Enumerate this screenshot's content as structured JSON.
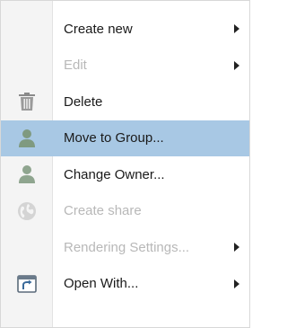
{
  "menu": {
    "items": [
      {
        "label": "Create new",
        "icon": "",
        "submenu": true,
        "disabled": false,
        "highlighted": false
      },
      {
        "label": "Edit",
        "icon": "",
        "submenu": true,
        "disabled": true,
        "highlighted": false
      },
      {
        "label": "Delete",
        "icon": "trash-icon",
        "submenu": false,
        "disabled": false,
        "highlighted": false
      },
      {
        "label": "Move to Group...",
        "icon": "user-icon",
        "submenu": false,
        "disabled": false,
        "highlighted": true
      },
      {
        "label": "Change Owner...",
        "icon": "user-icon",
        "submenu": false,
        "disabled": false,
        "highlighted": false
      },
      {
        "label": "Create share",
        "icon": "globe-icon",
        "submenu": false,
        "disabled": true,
        "highlighted": false
      },
      {
        "label": "Rendering Settings...",
        "icon": "",
        "submenu": true,
        "disabled": true,
        "highlighted": false
      },
      {
        "label": "Open With...",
        "icon": "open-with-icon",
        "submenu": true,
        "disabled": false,
        "highlighted": false
      }
    ]
  },
  "colors": {
    "highlight": "#a8c8e4",
    "gutter": "#f4f4f4",
    "text": "#1a1a1a",
    "disabled_text": "#b8b8b8"
  }
}
